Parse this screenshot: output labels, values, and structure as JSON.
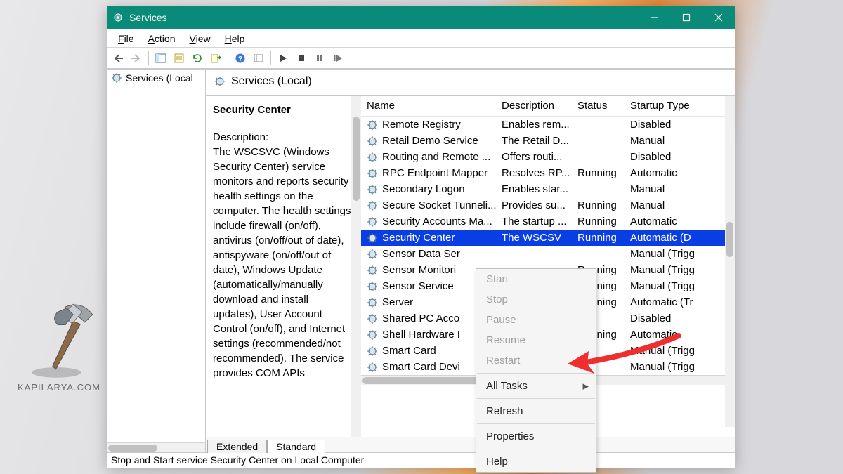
{
  "window": {
    "title": "Services"
  },
  "menu": {
    "file": "File",
    "action": "Action",
    "view": "View",
    "help": "Help"
  },
  "tree": {
    "root": "Services (Local"
  },
  "panel_title": "Services (Local)",
  "detail": {
    "name": "Security Center",
    "desc_label": "Description:",
    "desc": "The WSCSVC (Windows Security Center) service monitors and reports security health settings on the computer.  The health settings include firewall (on/off), antivirus (on/off/out of date), antispyware (on/off/out of date), Windows Update (automatically/manually download and install updates), User Account Control (on/off), and Internet settings (recommended/not recommended). The service provides COM APIs"
  },
  "columns": {
    "name": "Name",
    "desc": "Description",
    "status": "Status",
    "startup": "Startup Type"
  },
  "services": [
    {
      "name": "Remote Registry",
      "desc": "Enables rem...",
      "status": "",
      "startup": "Disabled"
    },
    {
      "name": "Retail Demo Service",
      "desc": "The Retail D...",
      "status": "",
      "startup": "Manual"
    },
    {
      "name": "Routing and Remote ...",
      "desc": "Offers routi...",
      "status": "",
      "startup": "Disabled"
    },
    {
      "name": "RPC Endpoint Mapper",
      "desc": "Resolves RP...",
      "status": "Running",
      "startup": "Automatic"
    },
    {
      "name": "Secondary Logon",
      "desc": "Enables star...",
      "status": "",
      "startup": "Manual"
    },
    {
      "name": "Secure Socket Tunneli...",
      "desc": "Provides su...",
      "status": "Running",
      "startup": "Manual"
    },
    {
      "name": "Security Accounts Ma...",
      "desc": "The startup ...",
      "status": "Running",
      "startup": "Automatic"
    },
    {
      "name": "Security Center",
      "desc": "The WSCSV",
      "status": "Running",
      "startup": "Automatic (D",
      "selected": true
    },
    {
      "name": "Sensor Data Ser",
      "desc": "",
      "status": "",
      "startup": "Manual (Trigg"
    },
    {
      "name": "Sensor Monitori",
      "desc": "",
      "status": "Running",
      "startup": "Manual (Trigg"
    },
    {
      "name": "Sensor Service",
      "desc": "",
      "status": "Running",
      "startup": "Manual (Trigg"
    },
    {
      "name": "Server",
      "desc": "",
      "status": "Running",
      "startup": "Automatic (Tr"
    },
    {
      "name": "Shared PC Acco",
      "desc": "",
      "status": "",
      "startup": "Disabled"
    },
    {
      "name": "Shell Hardware I",
      "desc": "",
      "status": "Running",
      "startup": "Automatic"
    },
    {
      "name": "Smart Card",
      "desc": "",
      "status": "",
      "startup": "Manual (Trigg"
    },
    {
      "name": "Smart Card Devi",
      "desc": "",
      "status": "",
      "startup": "Manual (Trigg"
    }
  ],
  "tabs": {
    "extended": "Extended",
    "standard": "Standard"
  },
  "statusbar": "Stop and Start service Security Center on Local Computer",
  "context_menu": {
    "start": "Start",
    "stop": "Stop",
    "pause": "Pause",
    "resume": "Resume",
    "restart": "Restart",
    "alltasks": "All Tasks",
    "refresh": "Refresh",
    "properties": "Properties",
    "help": "Help"
  },
  "watermark": "KAPILARYA.COM"
}
